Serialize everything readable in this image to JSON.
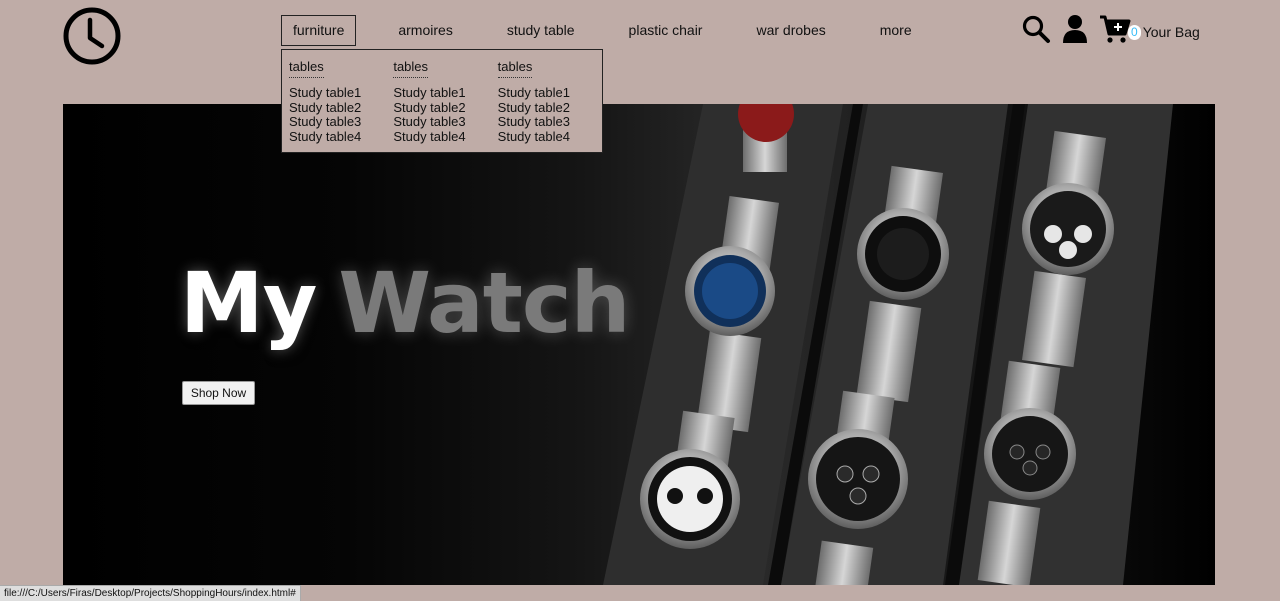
{
  "header": {
    "nav": [
      {
        "label": "furniture",
        "active": true
      },
      {
        "label": "armoires"
      },
      {
        "label": "study table"
      },
      {
        "label": "plastic chair"
      },
      {
        "label": "war drobes"
      },
      {
        "label": "more"
      }
    ],
    "icons": [
      "clock-icon",
      "search-icon",
      "user-icon",
      "cart-icon"
    ],
    "bag": {
      "count": "0",
      "label": "Your Bag"
    }
  },
  "dropdown": {
    "columns": [
      {
        "heading": "tables",
        "links": [
          "Study table1",
          "Study table2",
          "Study table3",
          "Study table4"
        ]
      },
      {
        "heading": "tables",
        "links": [
          "Study table1",
          "Study table2",
          "Study table3",
          "Study table4"
        ]
      },
      {
        "heading": "tables",
        "links": [
          "Study table1",
          "Study table2",
          "Study table3",
          "Study table4"
        ]
      }
    ]
  },
  "hero": {
    "title_word1": "My",
    "title_word2": "Watch",
    "button": "Shop Now"
  },
  "status_bar": {
    "url": "file:///C:/Users/Firas/Desktop/Projects/ShoppingHours/index.html#"
  },
  "colors": {
    "page_bg": "#bfaca7",
    "hero_bg": "#000000",
    "badge_text": "#38bdf8"
  }
}
